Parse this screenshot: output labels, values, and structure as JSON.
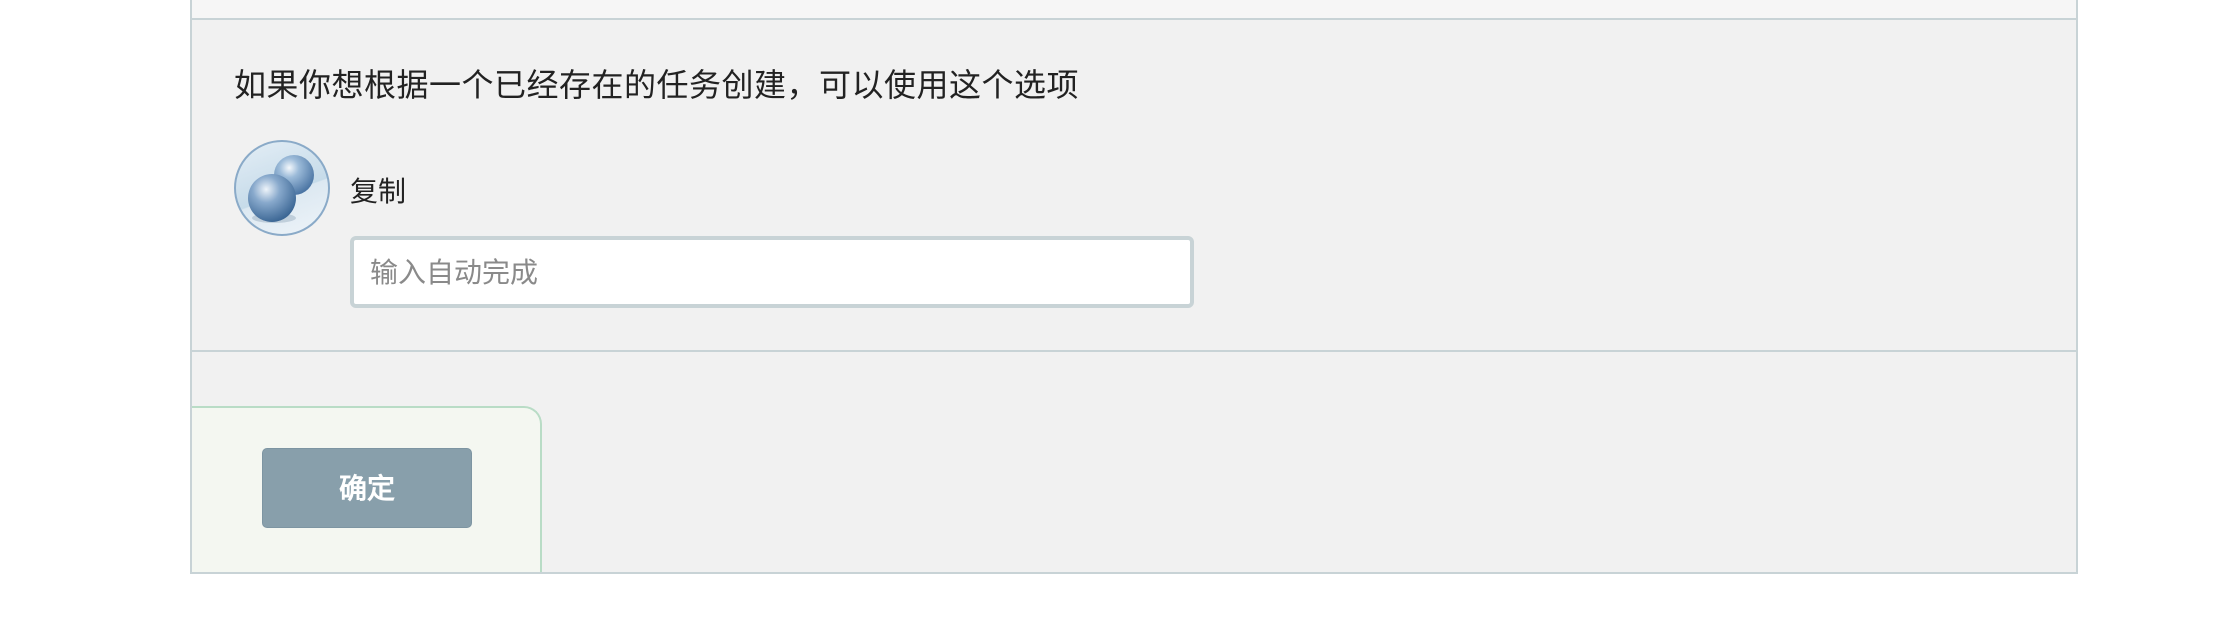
{
  "copy_section": {
    "description": "如果你想根据一个已经存在的任务创建，可以使用这个选项",
    "option_label": "复制",
    "input": {
      "value": "",
      "placeholder": "输入自动完成"
    },
    "icon": "copy-spheres-icon"
  },
  "actions": {
    "confirm_label": "确定"
  },
  "colors": {
    "panel_background": "#f1f1f1",
    "border": "#c8d3d6",
    "action_box_background": "#f4f7f1",
    "action_box_border": "#b9dcc6",
    "button_background": "#889fab",
    "button_text": "#ffffff"
  }
}
